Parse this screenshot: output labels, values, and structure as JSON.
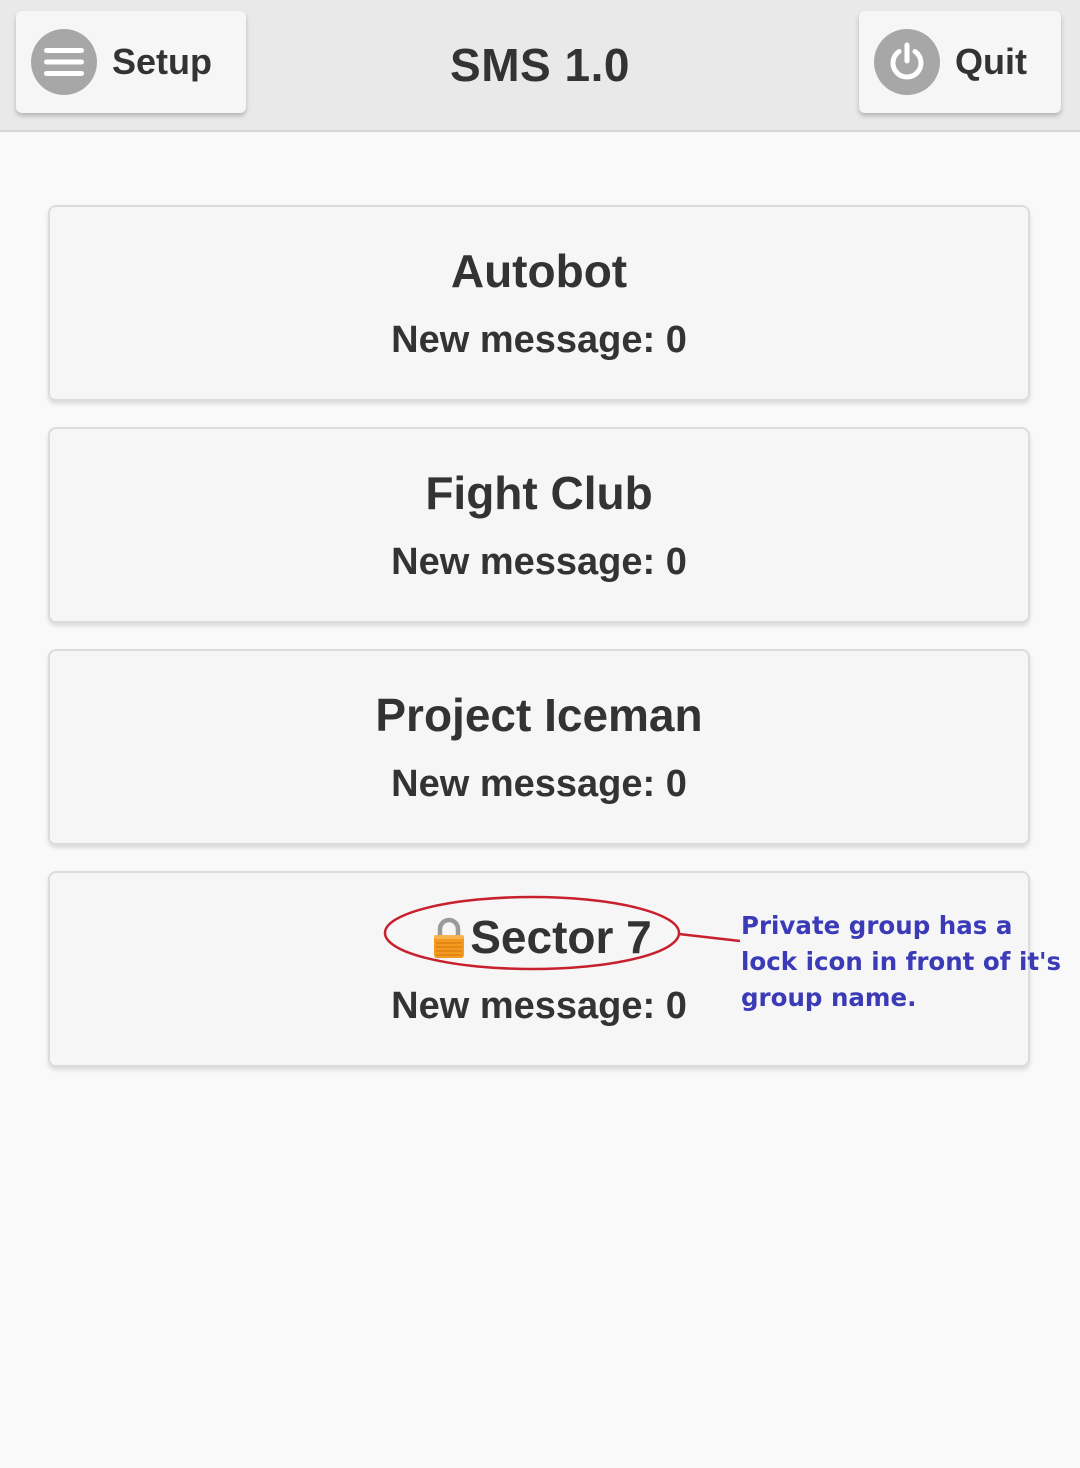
{
  "header": {
    "title": "SMS 1.0",
    "setup_label": "Setup",
    "setup_icon": "menu-icon",
    "quit_label": "Quit",
    "quit_icon": "power-icon"
  },
  "groups": [
    {
      "name": "Autobot",
      "new_message": "New message: 0",
      "private": false
    },
    {
      "name": "Fight Club",
      "new_message": "New message: 0",
      "private": false
    },
    {
      "name": "Project Iceman",
      "new_message": "New message: 0",
      "private": false
    },
    {
      "name": "Sector 7",
      "new_message": "New message: 0",
      "private": true,
      "icon": "lock-icon"
    }
  ],
  "annotation": {
    "text": "Private group has a lock icon in front of it's group name.",
    "color": "#3b3bb8",
    "marker_color": "#c8202c"
  },
  "colors": {
    "header_bg": "#e9e9e9",
    "icon_circle": "#a7a7a7",
    "card_bg": "#f6f6f6",
    "text": "#333333"
  }
}
